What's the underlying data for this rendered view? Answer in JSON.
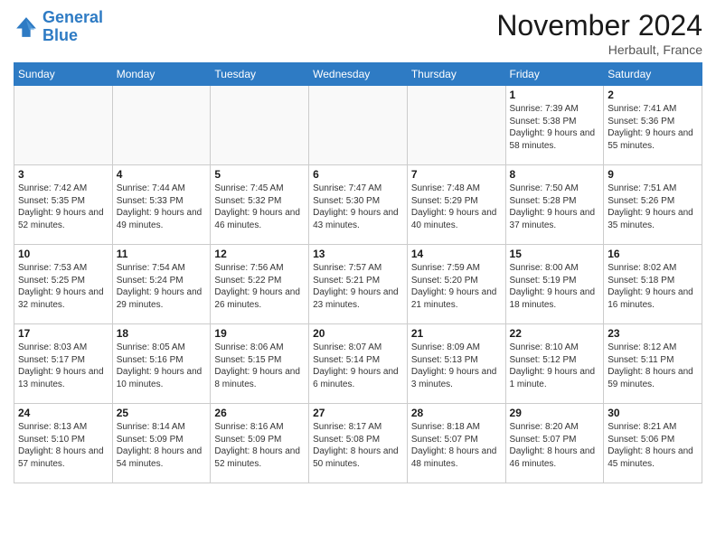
{
  "header": {
    "logo_line1": "General",
    "logo_line2": "Blue",
    "month": "November 2024",
    "location": "Herbault, France"
  },
  "weekdays": [
    "Sunday",
    "Monday",
    "Tuesday",
    "Wednesday",
    "Thursday",
    "Friday",
    "Saturday"
  ],
  "weeks": [
    [
      {
        "day": "",
        "empty": true
      },
      {
        "day": "",
        "empty": true
      },
      {
        "day": "",
        "empty": true
      },
      {
        "day": "",
        "empty": true
      },
      {
        "day": "",
        "empty": true
      },
      {
        "day": "1",
        "sunrise": "7:39 AM",
        "sunset": "5:38 PM",
        "daylight": "9 hours and 58 minutes."
      },
      {
        "day": "2",
        "sunrise": "7:41 AM",
        "sunset": "5:36 PM",
        "daylight": "9 hours and 55 minutes."
      }
    ],
    [
      {
        "day": "3",
        "sunrise": "7:42 AM",
        "sunset": "5:35 PM",
        "daylight": "9 hours and 52 minutes."
      },
      {
        "day": "4",
        "sunrise": "7:44 AM",
        "sunset": "5:33 PM",
        "daylight": "9 hours and 49 minutes."
      },
      {
        "day": "5",
        "sunrise": "7:45 AM",
        "sunset": "5:32 PM",
        "daylight": "9 hours and 46 minutes."
      },
      {
        "day": "6",
        "sunrise": "7:47 AM",
        "sunset": "5:30 PM",
        "daylight": "9 hours and 43 minutes."
      },
      {
        "day": "7",
        "sunrise": "7:48 AM",
        "sunset": "5:29 PM",
        "daylight": "9 hours and 40 minutes."
      },
      {
        "day": "8",
        "sunrise": "7:50 AM",
        "sunset": "5:28 PM",
        "daylight": "9 hours and 37 minutes."
      },
      {
        "day": "9",
        "sunrise": "7:51 AM",
        "sunset": "5:26 PM",
        "daylight": "9 hours and 35 minutes."
      }
    ],
    [
      {
        "day": "10",
        "sunrise": "7:53 AM",
        "sunset": "5:25 PM",
        "daylight": "9 hours and 32 minutes."
      },
      {
        "day": "11",
        "sunrise": "7:54 AM",
        "sunset": "5:24 PM",
        "daylight": "9 hours and 29 minutes."
      },
      {
        "day": "12",
        "sunrise": "7:56 AM",
        "sunset": "5:22 PM",
        "daylight": "9 hours and 26 minutes."
      },
      {
        "day": "13",
        "sunrise": "7:57 AM",
        "sunset": "5:21 PM",
        "daylight": "9 hours and 23 minutes."
      },
      {
        "day": "14",
        "sunrise": "7:59 AM",
        "sunset": "5:20 PM",
        "daylight": "9 hours and 21 minutes."
      },
      {
        "day": "15",
        "sunrise": "8:00 AM",
        "sunset": "5:19 PM",
        "daylight": "9 hours and 18 minutes."
      },
      {
        "day": "16",
        "sunrise": "8:02 AM",
        "sunset": "5:18 PM",
        "daylight": "9 hours and 16 minutes."
      }
    ],
    [
      {
        "day": "17",
        "sunrise": "8:03 AM",
        "sunset": "5:17 PM",
        "daylight": "9 hours and 13 minutes."
      },
      {
        "day": "18",
        "sunrise": "8:05 AM",
        "sunset": "5:16 PM",
        "daylight": "9 hours and 10 minutes."
      },
      {
        "day": "19",
        "sunrise": "8:06 AM",
        "sunset": "5:15 PM",
        "daylight": "9 hours and 8 minutes."
      },
      {
        "day": "20",
        "sunrise": "8:07 AM",
        "sunset": "5:14 PM",
        "daylight": "9 hours and 6 minutes."
      },
      {
        "day": "21",
        "sunrise": "8:09 AM",
        "sunset": "5:13 PM",
        "daylight": "9 hours and 3 minutes."
      },
      {
        "day": "22",
        "sunrise": "8:10 AM",
        "sunset": "5:12 PM",
        "daylight": "9 hours and 1 minute."
      },
      {
        "day": "23",
        "sunrise": "8:12 AM",
        "sunset": "5:11 PM",
        "daylight": "8 hours and 59 minutes."
      }
    ],
    [
      {
        "day": "24",
        "sunrise": "8:13 AM",
        "sunset": "5:10 PM",
        "daylight": "8 hours and 57 minutes."
      },
      {
        "day": "25",
        "sunrise": "8:14 AM",
        "sunset": "5:09 PM",
        "daylight": "8 hours and 54 minutes."
      },
      {
        "day": "26",
        "sunrise": "8:16 AM",
        "sunset": "5:09 PM",
        "daylight": "8 hours and 52 minutes."
      },
      {
        "day": "27",
        "sunrise": "8:17 AM",
        "sunset": "5:08 PM",
        "daylight": "8 hours and 50 minutes."
      },
      {
        "day": "28",
        "sunrise": "8:18 AM",
        "sunset": "5:07 PM",
        "daylight": "8 hours and 48 minutes."
      },
      {
        "day": "29",
        "sunrise": "8:20 AM",
        "sunset": "5:07 PM",
        "daylight": "8 hours and 46 minutes."
      },
      {
        "day": "30",
        "sunrise": "8:21 AM",
        "sunset": "5:06 PM",
        "daylight": "8 hours and 45 minutes."
      }
    ]
  ]
}
